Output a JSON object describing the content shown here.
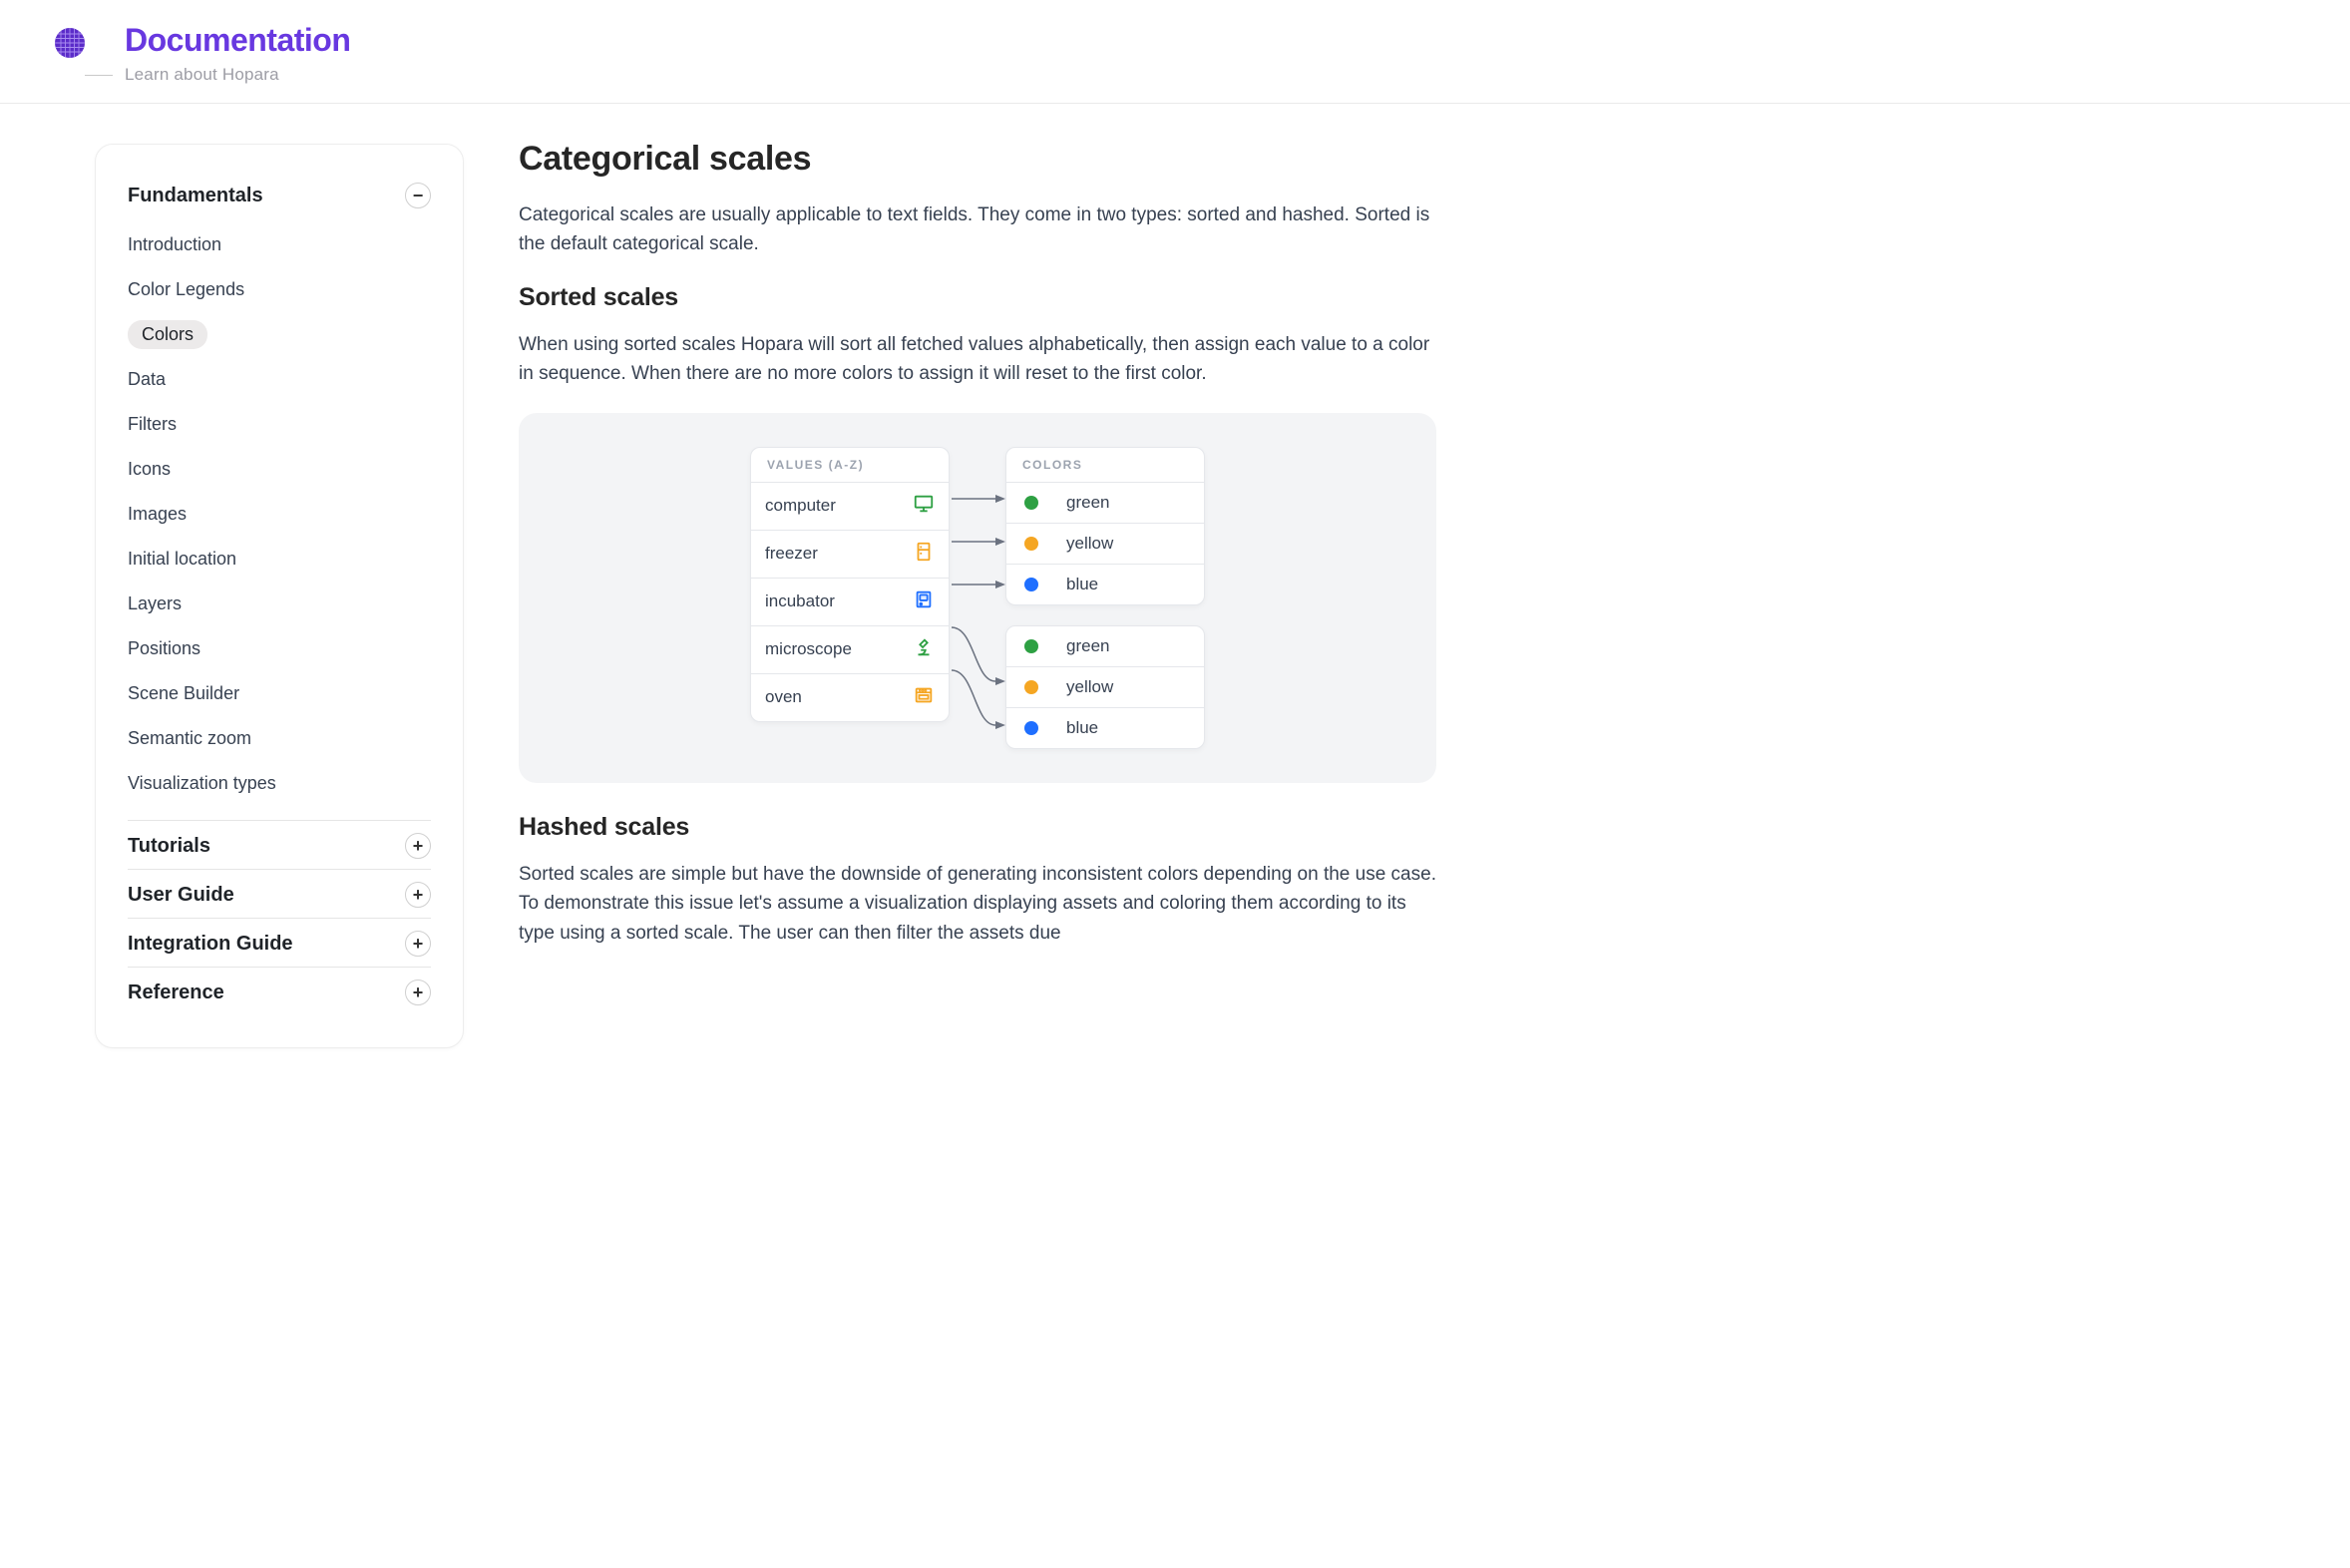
{
  "header": {
    "title": "Documentation",
    "tagline": "Learn about Hopara"
  },
  "sidebar": {
    "sections": [
      {
        "title": "Fundamentals",
        "expanded": true,
        "items": [
          "Introduction",
          "Color Legends",
          "Colors",
          "Data",
          "Filters",
          "Icons",
          "Images",
          "Initial location",
          "Layers",
          "Positions",
          "Scene Builder",
          "Semantic zoom",
          "Visualization types"
        ],
        "active_index": 2
      },
      {
        "title": "Tutorials",
        "expanded": false
      },
      {
        "title": "User Guide",
        "expanded": false
      },
      {
        "title": "Integration Guide",
        "expanded": false
      },
      {
        "title": "Reference",
        "expanded": false
      }
    ]
  },
  "content": {
    "h2": "Categorical scales",
    "p1": "Categorical scales are usually applicable to text fields. They come in two types: sorted and hashed. Sorted is the default categorical scale.",
    "h3a": "Sorted scales",
    "p2": "When using sorted scales Hopara will sort all fetched values alphabetically, then assign each value to a color in sequence. When there are no more colors to assign it will reset to the first color.",
    "h3b": "Hashed scales",
    "p3": "Sorted scales are simple but have the downside of generating inconsistent colors depending on the use case. To demonstrate this issue let's assume a visualization displaying assets and coloring them according to its type using a sorted scale. The user can then filter the assets due"
  },
  "diagram": {
    "values_header": "VALUES (A-Z)",
    "colors_header": "COLORS",
    "values": [
      {
        "label": "computer",
        "icon": "computer"
      },
      {
        "label": "freezer",
        "icon": "freezer"
      },
      {
        "label": "incubator",
        "icon": "incubator"
      },
      {
        "label": "microscope",
        "icon": "microscope"
      },
      {
        "label": "oven",
        "icon": "oven"
      }
    ],
    "colors1": [
      {
        "label": "green",
        "swatch": "green"
      },
      {
        "label": "yellow",
        "swatch": "yellow"
      },
      {
        "label": "blue",
        "swatch": "blue"
      }
    ],
    "colors2": [
      {
        "label": "green",
        "swatch": "green"
      },
      {
        "label": "yellow",
        "swatch": "yellow"
      },
      {
        "label": "blue",
        "swatch": "blue"
      }
    ]
  }
}
